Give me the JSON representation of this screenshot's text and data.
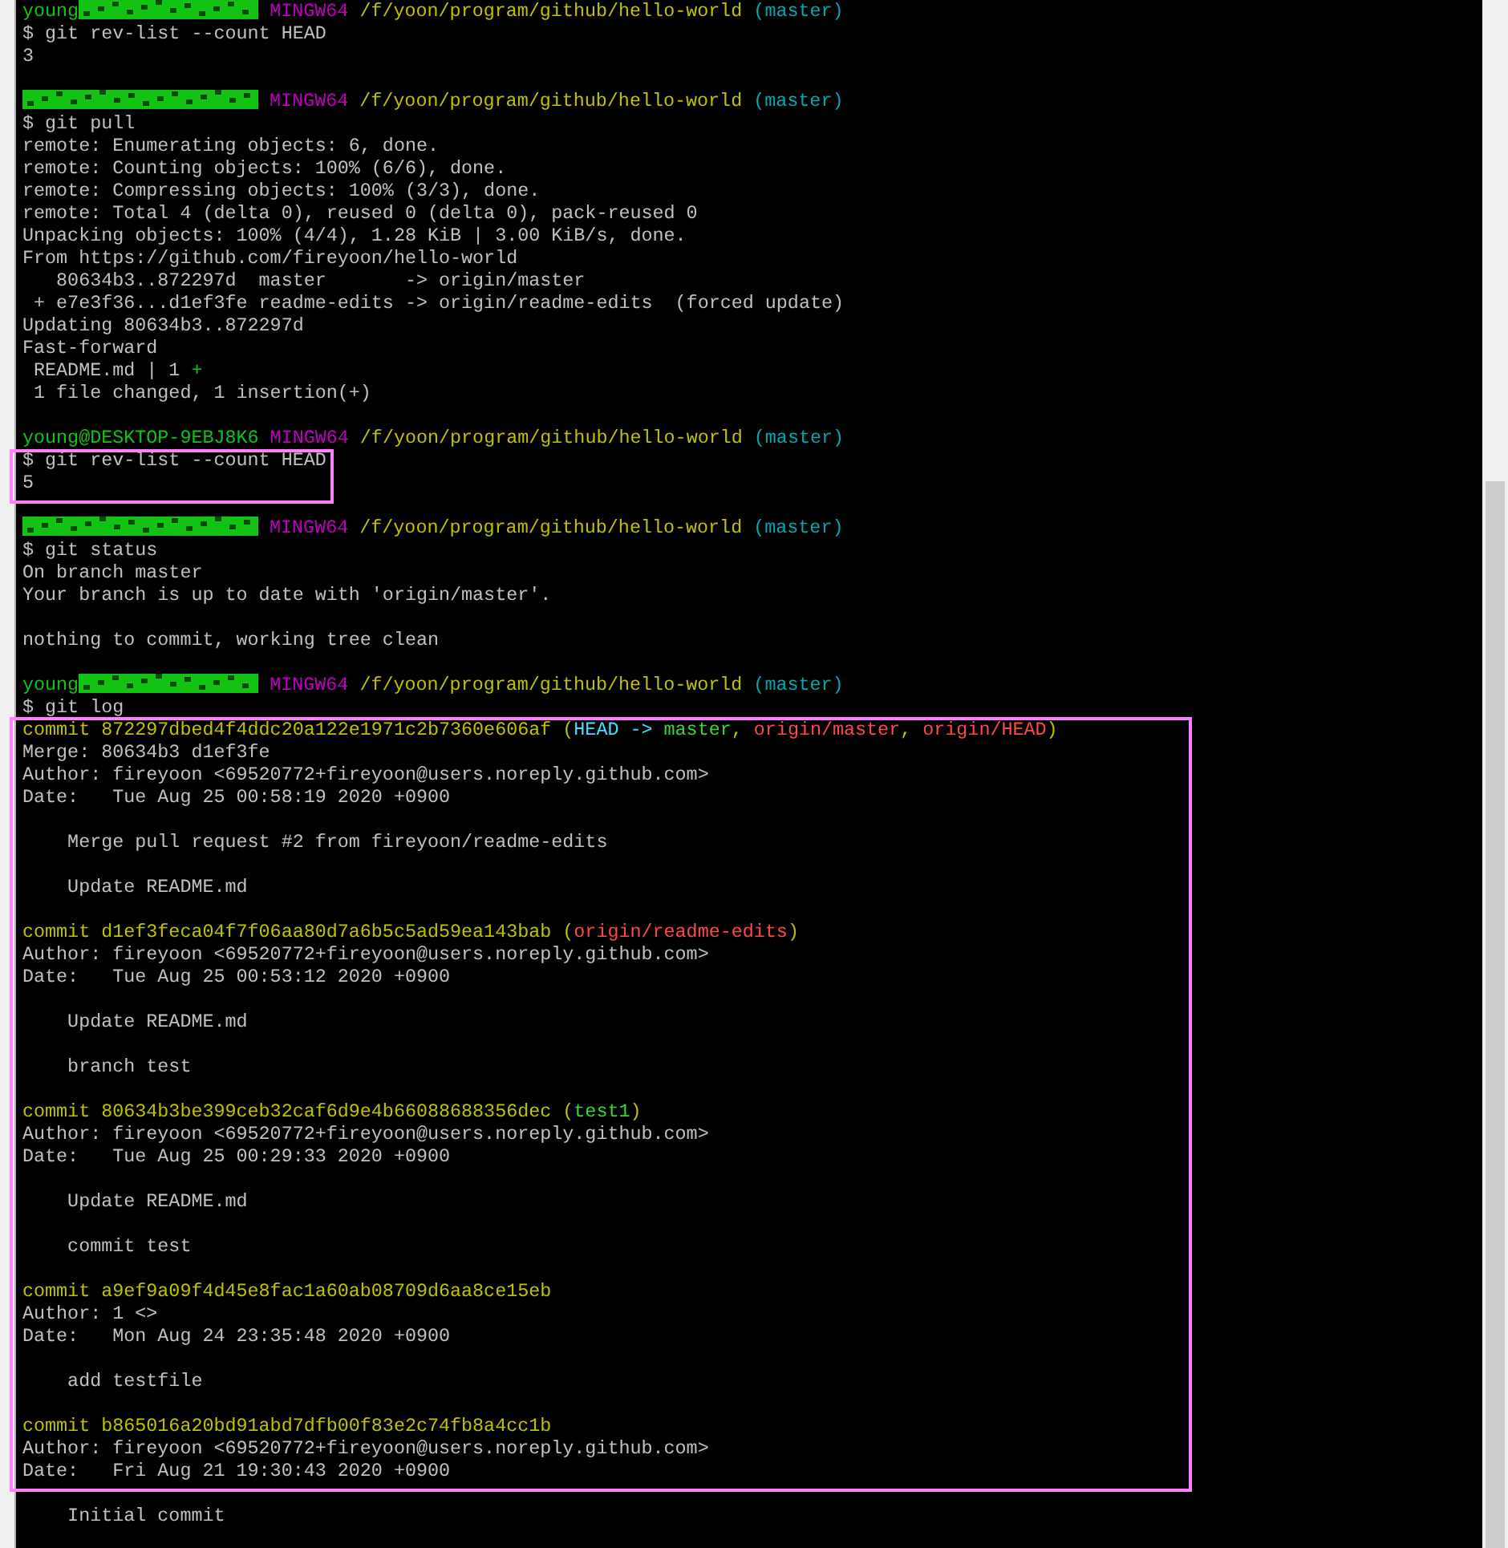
{
  "terminal": {
    "lines": [
      {
        "kind": "segments",
        "segments": [
          {
            "text": "young",
            "color": "#13c313"
          },
          {
            "kind": "redacted",
            "color": "#13c313"
          },
          {
            "text": " MINGW64",
            "color": "#c000c0"
          },
          {
            "text": " /f/yoon/program/github/hello-world",
            "color": "#c0c000"
          },
          {
            "text": " (master)",
            "color": "#00a8b0"
          }
        ]
      },
      {
        "kind": "plain",
        "text": "$ git rev-list --count HEAD"
      },
      {
        "kind": "plain",
        "text": "3"
      },
      {
        "kind": "blank"
      },
      {
        "kind": "segments",
        "segments": [
          {
            "kind": "redacted",
            "color": "#13c313"
          },
          {
            "text": " MINGW64",
            "color": "#c000c0"
          },
          {
            "text": " /f/yoon/program/github/hello-world",
            "color": "#c0c000"
          },
          {
            "text": " (master)",
            "color": "#00a8b0"
          }
        ]
      },
      {
        "kind": "plain",
        "text": "$ git pull"
      },
      {
        "kind": "plain",
        "text": "remote: Enumerating objects: 6, done."
      },
      {
        "kind": "plain",
        "text": "remote: Counting objects: 100% (6/6), done."
      },
      {
        "kind": "plain",
        "text": "remote: Compressing objects: 100% (3/3), done."
      },
      {
        "kind": "plain",
        "text": "remote: Total 4 (delta 0), reused 0 (delta 0), pack-reused 0"
      },
      {
        "kind": "plain",
        "text": "Unpacking objects: 100% (4/4), 1.28 KiB | 3.00 KiB/s, done."
      },
      {
        "kind": "plain",
        "text": "From https://github.com/fireyoon/hello-world"
      },
      {
        "kind": "plain",
        "text": "   80634b3..872297d  master       -> origin/master"
      },
      {
        "kind": "plain",
        "text": " + e7e3f36...d1ef3fe readme-edits -> origin/readme-edits  (forced update)"
      },
      {
        "kind": "plain",
        "text": "Updating 80634b3..872297d"
      },
      {
        "kind": "plain",
        "text": "Fast-forward"
      },
      {
        "kind": "segments",
        "segments": [
          {
            "text": " README.md | 1 ",
            "color": "#c0c0c0"
          },
          {
            "text": "+",
            "color": "#13c313"
          }
        ]
      },
      {
        "kind": "plain",
        "text": " 1 file changed, 1 insertion(+)"
      },
      {
        "kind": "blank"
      },
      {
        "kind": "segments",
        "segments": [
          {
            "text": "young@DESKTOP-9EBJ8K6",
            "color": "#13c313"
          },
          {
            "text": " MINGW64",
            "color": "#c000c0"
          },
          {
            "text": " /f/yoon/program/github/hello-world",
            "color": "#c0c000"
          },
          {
            "text": " (master)",
            "color": "#00a8b0"
          }
        ]
      },
      {
        "kind": "plain",
        "text": "$ git rev-list --count HEAD"
      },
      {
        "kind": "plain",
        "text": "5"
      },
      {
        "kind": "blank"
      },
      {
        "kind": "segments",
        "segments": [
          {
            "kind": "redacted",
            "color": "#13c313"
          },
          {
            "text": " MINGW64",
            "color": "#c000c0"
          },
          {
            "text": " /f/yoon/program/github/hello-world",
            "color": "#c0c000"
          },
          {
            "text": " (master)",
            "color": "#00a8b0"
          }
        ]
      },
      {
        "kind": "plain",
        "text": "$ git status"
      },
      {
        "kind": "plain",
        "text": "On branch master"
      },
      {
        "kind": "plain",
        "text": "Your branch is up to date with 'origin/master'."
      },
      {
        "kind": "blank"
      },
      {
        "kind": "plain",
        "text": "nothing to commit, working tree clean"
      },
      {
        "kind": "blank"
      },
      {
        "kind": "segments",
        "segments": [
          {
            "text": "young",
            "color": "#13c313"
          },
          {
            "kind": "redacted",
            "color": "#13c313"
          },
          {
            "text": " MINGW64",
            "color": "#c000c0"
          },
          {
            "text": " /f/yoon/program/github/hello-world",
            "color": "#c0c000"
          },
          {
            "text": " (master)",
            "color": "#00a8b0"
          }
        ]
      },
      {
        "kind": "plain",
        "text": "$ git log"
      },
      {
        "kind": "segments",
        "segments": [
          {
            "text": "commit 872297dbed4f4ddc20a122e1971c2b7360e606af (",
            "color": "#c0c000"
          },
          {
            "text": "HEAD -> ",
            "color": "#40e0ff"
          },
          {
            "text": "master",
            "color": "#3ad53a"
          },
          {
            "text": ", ",
            "color": "#c0c000"
          },
          {
            "text": "origin/master",
            "color": "#ff4848"
          },
          {
            "text": ", ",
            "color": "#c0c000"
          },
          {
            "text": "origin/HEAD",
            "color": "#ff4848"
          },
          {
            "text": ")",
            "color": "#c0c000"
          }
        ]
      },
      {
        "kind": "plain",
        "text": "Merge: 80634b3 d1ef3fe"
      },
      {
        "kind": "plain",
        "text": "Author: fireyoon <69520772+fireyoon@users.noreply.github.com>"
      },
      {
        "kind": "plain",
        "text": "Date:   Tue Aug 25 00:58:19 2020 +0900"
      },
      {
        "kind": "blank"
      },
      {
        "kind": "plain",
        "text": "    Merge pull request #2 from fireyoon/readme-edits"
      },
      {
        "kind": "blank"
      },
      {
        "kind": "plain",
        "text": "    Update README.md"
      },
      {
        "kind": "blank"
      },
      {
        "kind": "segments",
        "segments": [
          {
            "text": "commit d1ef3feca04f7f06aa80d7a6b5c5ad59ea143bab (",
            "color": "#c0c000"
          },
          {
            "text": "origin/readme-edits",
            "color": "#ff4848"
          },
          {
            "text": ")",
            "color": "#c0c000"
          }
        ]
      },
      {
        "kind": "plain",
        "text": "Author: fireyoon <69520772+fireyoon@users.noreply.github.com>"
      },
      {
        "kind": "plain",
        "text": "Date:   Tue Aug 25 00:53:12 2020 +0900"
      },
      {
        "kind": "blank"
      },
      {
        "kind": "plain",
        "text": "    Update README.md"
      },
      {
        "kind": "blank"
      },
      {
        "kind": "plain",
        "text": "    branch test"
      },
      {
        "kind": "blank"
      },
      {
        "kind": "segments",
        "segments": [
          {
            "text": "commit 80634b3be399ceb32caf6d9e4b66088688356dec (",
            "color": "#c0c000"
          },
          {
            "text": "test1",
            "color": "#3ad53a"
          },
          {
            "text": ")",
            "color": "#c0c000"
          }
        ]
      },
      {
        "kind": "plain",
        "text": "Author: fireyoon <69520772+fireyoon@users.noreply.github.com>"
      },
      {
        "kind": "plain",
        "text": "Date:   Tue Aug 25 00:29:33 2020 +0900"
      },
      {
        "kind": "blank"
      },
      {
        "kind": "plain",
        "text": "    Update README.md"
      },
      {
        "kind": "blank"
      },
      {
        "kind": "plain",
        "text": "    commit test"
      },
      {
        "kind": "blank"
      },
      {
        "kind": "segments",
        "segments": [
          {
            "text": "commit a9ef9a09f4d45e8fac1a60ab08709d6aa8ce15eb",
            "color": "#c0c000"
          }
        ]
      },
      {
        "kind": "plain",
        "text": "Author: 1 <>"
      },
      {
        "kind": "plain",
        "text": "Date:   Mon Aug 24 23:35:48 2020 +0900"
      },
      {
        "kind": "blank"
      },
      {
        "kind": "plain",
        "text": "    add testfile"
      },
      {
        "kind": "blank"
      },
      {
        "kind": "segments",
        "segments": [
          {
            "text": "commit b865016a20bd91abd7dfb00f83e2c74fb8a4cc1b",
            "color": "#c0c000"
          }
        ]
      },
      {
        "kind": "plain",
        "text": "Author: fireyoon <69520772+fireyoon@users.noreply.github.com>"
      },
      {
        "kind": "plain",
        "text": "Date:   Fri Aug 21 19:30:43 2020 +0900"
      },
      {
        "kind": "blank"
      },
      {
        "kind": "plain",
        "text": "    Initial commit"
      }
    ]
  }
}
